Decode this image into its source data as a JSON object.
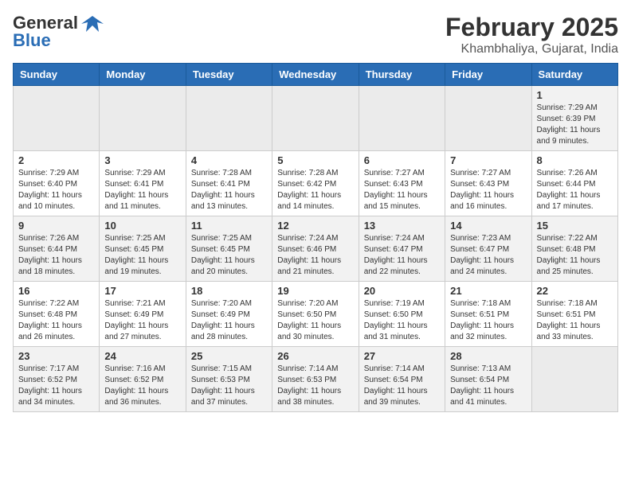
{
  "header": {
    "logo_general": "General",
    "logo_blue": "Blue",
    "month_year": "February 2025",
    "location": "Khambhaliya, Gujarat, India"
  },
  "weekdays": [
    "Sunday",
    "Monday",
    "Tuesday",
    "Wednesday",
    "Thursday",
    "Friday",
    "Saturday"
  ],
  "weeks": [
    [
      {
        "day": "",
        "info": ""
      },
      {
        "day": "",
        "info": ""
      },
      {
        "day": "",
        "info": ""
      },
      {
        "day": "",
        "info": ""
      },
      {
        "day": "",
        "info": ""
      },
      {
        "day": "",
        "info": ""
      },
      {
        "day": "1",
        "info": "Sunrise: 7:29 AM\nSunset: 6:39 PM\nDaylight: 11 hours and 9 minutes."
      }
    ],
    [
      {
        "day": "2",
        "info": "Sunrise: 7:29 AM\nSunset: 6:40 PM\nDaylight: 11 hours and 10 minutes."
      },
      {
        "day": "3",
        "info": "Sunrise: 7:29 AM\nSunset: 6:41 PM\nDaylight: 11 hours and 11 minutes."
      },
      {
        "day": "4",
        "info": "Sunrise: 7:28 AM\nSunset: 6:41 PM\nDaylight: 11 hours and 13 minutes."
      },
      {
        "day": "5",
        "info": "Sunrise: 7:28 AM\nSunset: 6:42 PM\nDaylight: 11 hours and 14 minutes."
      },
      {
        "day": "6",
        "info": "Sunrise: 7:27 AM\nSunset: 6:43 PM\nDaylight: 11 hours and 15 minutes."
      },
      {
        "day": "7",
        "info": "Sunrise: 7:27 AM\nSunset: 6:43 PM\nDaylight: 11 hours and 16 minutes."
      },
      {
        "day": "8",
        "info": "Sunrise: 7:26 AM\nSunset: 6:44 PM\nDaylight: 11 hours and 17 minutes."
      }
    ],
    [
      {
        "day": "9",
        "info": "Sunrise: 7:26 AM\nSunset: 6:44 PM\nDaylight: 11 hours and 18 minutes."
      },
      {
        "day": "10",
        "info": "Sunrise: 7:25 AM\nSunset: 6:45 PM\nDaylight: 11 hours and 19 minutes."
      },
      {
        "day": "11",
        "info": "Sunrise: 7:25 AM\nSunset: 6:45 PM\nDaylight: 11 hours and 20 minutes."
      },
      {
        "day": "12",
        "info": "Sunrise: 7:24 AM\nSunset: 6:46 PM\nDaylight: 11 hours and 21 minutes."
      },
      {
        "day": "13",
        "info": "Sunrise: 7:24 AM\nSunset: 6:47 PM\nDaylight: 11 hours and 22 minutes."
      },
      {
        "day": "14",
        "info": "Sunrise: 7:23 AM\nSunset: 6:47 PM\nDaylight: 11 hours and 24 minutes."
      },
      {
        "day": "15",
        "info": "Sunrise: 7:22 AM\nSunset: 6:48 PM\nDaylight: 11 hours and 25 minutes."
      }
    ],
    [
      {
        "day": "16",
        "info": "Sunrise: 7:22 AM\nSunset: 6:48 PM\nDaylight: 11 hours and 26 minutes."
      },
      {
        "day": "17",
        "info": "Sunrise: 7:21 AM\nSunset: 6:49 PM\nDaylight: 11 hours and 27 minutes."
      },
      {
        "day": "18",
        "info": "Sunrise: 7:20 AM\nSunset: 6:49 PM\nDaylight: 11 hours and 28 minutes."
      },
      {
        "day": "19",
        "info": "Sunrise: 7:20 AM\nSunset: 6:50 PM\nDaylight: 11 hours and 30 minutes."
      },
      {
        "day": "20",
        "info": "Sunrise: 7:19 AM\nSunset: 6:50 PM\nDaylight: 11 hours and 31 minutes."
      },
      {
        "day": "21",
        "info": "Sunrise: 7:18 AM\nSunset: 6:51 PM\nDaylight: 11 hours and 32 minutes."
      },
      {
        "day": "22",
        "info": "Sunrise: 7:18 AM\nSunset: 6:51 PM\nDaylight: 11 hours and 33 minutes."
      }
    ],
    [
      {
        "day": "23",
        "info": "Sunrise: 7:17 AM\nSunset: 6:52 PM\nDaylight: 11 hours and 34 minutes."
      },
      {
        "day": "24",
        "info": "Sunrise: 7:16 AM\nSunset: 6:52 PM\nDaylight: 11 hours and 36 minutes."
      },
      {
        "day": "25",
        "info": "Sunrise: 7:15 AM\nSunset: 6:53 PM\nDaylight: 11 hours and 37 minutes."
      },
      {
        "day": "26",
        "info": "Sunrise: 7:14 AM\nSunset: 6:53 PM\nDaylight: 11 hours and 38 minutes."
      },
      {
        "day": "27",
        "info": "Sunrise: 7:14 AM\nSunset: 6:54 PM\nDaylight: 11 hours and 39 minutes."
      },
      {
        "day": "28",
        "info": "Sunrise: 7:13 AM\nSunset: 6:54 PM\nDaylight: 11 hours and 41 minutes."
      },
      {
        "day": "",
        "info": ""
      }
    ]
  ]
}
